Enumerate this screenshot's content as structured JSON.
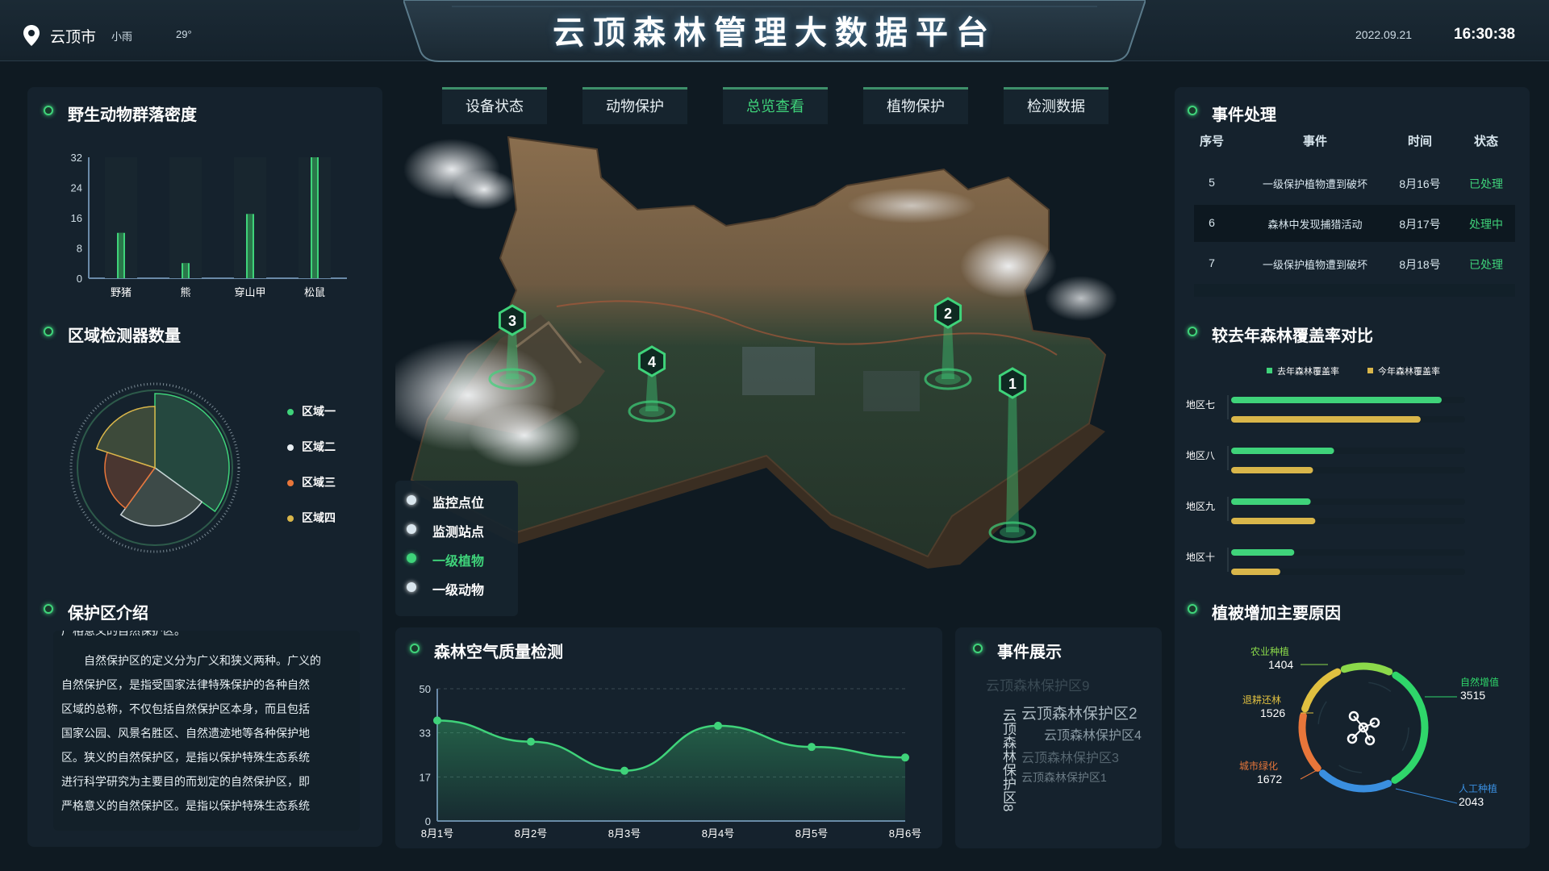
{
  "header": {
    "city": "云顶市",
    "weather": "小雨",
    "temperature": "29°",
    "title": "云顶森林管理大数据平台",
    "date": "2022.09.21",
    "time": "16:30:38"
  },
  "tabs": [
    {
      "label": "设备状态"
    },
    {
      "label": "动物保护"
    },
    {
      "label": "总览查看"
    },
    {
      "label": "植物保护"
    },
    {
      "label": "检测数据"
    }
  ],
  "wildlife": {
    "title": "野生动物群落密度",
    "chart_data": {
      "type": "bar",
      "categories": [
        "野猪",
        "熊",
        "穿山甲",
        "松鼠"
      ],
      "values": [
        12,
        4,
        17,
        32
      ],
      "yticks": [
        "32",
        "24",
        "16",
        "8",
        "0"
      ],
      "ylim": [
        0,
        32
      ],
      "color": "#3fd37a"
    }
  },
  "detectors": {
    "title": "区域检测器数量",
    "chart_data": {
      "type": "pie",
      "categories": [
        "区域一",
        "区域二",
        "区域三",
        "区域四"
      ],
      "values": [
        35,
        25,
        20,
        20
      ],
      "colors": [
        "#3fd37a",
        "#e8eef2",
        "#e8763a",
        "#d9b64a"
      ]
    }
  },
  "intro": {
    "title": "保护区介绍",
    "top_cut": "广格意义的自然保护区。",
    "lines": [
      "自然保护区的定义分为广义和狭义两种。广义的",
      "自然保护区，是指受国家法律特殊保护的各种自然",
      "区域的总称，不仅包括自然保护区本身，而且包括",
      "国家公园、风景名胜区、自然遗迹地等各种保护地",
      "区。狭义的自然保护区，是指以保护特殊生态系统",
      "进行科学研究为主要目的而划定的自然保护区，即",
      "严格意义的自然保护区。是指以保护特殊生态系统"
    ]
  },
  "map": {
    "markers": [
      "1",
      "2",
      "3",
      "4"
    ],
    "legend": [
      {
        "label": "监控点位"
      },
      {
        "label": "监测站点"
      },
      {
        "label": "一级植物"
      },
      {
        "label": "一级动物"
      }
    ]
  },
  "air": {
    "title": "森林空气质量检测",
    "chart_data": {
      "type": "line",
      "categories": [
        "8月1号",
        "8月2号",
        "8月3号",
        "8月4号",
        "8月5号",
        "8月6号"
      ],
      "values": [
        38,
        30,
        19,
        36,
        28,
        24
      ],
      "yticks": [
        "50",
        "33",
        "17",
        "0"
      ],
      "ylim": [
        0,
        50
      ],
      "color": "#3fd37a"
    }
  },
  "showcase": {
    "title": "事件展示",
    "items": [
      "云顶森林保护区9",
      "云顶森林保护区2",
      "云顶森林保护区4",
      "云顶森林保护区3",
      "云顶森林保护区1",
      "云顶森林保护区8"
    ]
  },
  "events": {
    "title": "事件处理",
    "headers": [
      "序号",
      "事件",
      "时间",
      "状态"
    ],
    "rows": [
      {
        "no": "5",
        "event": "一级保护植物遭到破坏",
        "time": "8月16号",
        "status": "已处理"
      },
      {
        "no": "6",
        "event": "森林中发现捕猎活动",
        "time": "8月17号",
        "status": "处理中"
      },
      {
        "no": "7",
        "event": "一级保护植物遭到破坏",
        "time": "8月18号",
        "status": "已处理"
      }
    ]
  },
  "coverage": {
    "title": "较去年森林覆盖率对比",
    "chart_data": {
      "type": "bar",
      "orientation": "horizontal",
      "categories": [
        "地区七",
        "地区八",
        "地区九",
        "地区十"
      ],
      "series": [
        {
          "name": "去年森林覆盖率",
          "values": [
            90,
            44,
            34,
            27
          ],
          "color": "#3fd37a"
        },
        {
          "name": "今年森林覆盖率",
          "values": [
            81,
            35,
            36,
            21
          ],
          "color": "#d9b64a"
        }
      ],
      "xlim": [
        0,
        100
      ]
    }
  },
  "vegetation": {
    "title": "植被增加主要原因",
    "chart_data": {
      "type": "pie",
      "categories": [
        "农业种植",
        "退耕还林",
        "城市绿化",
        "自然增值",
        "人工种植"
      ],
      "values": [
        1404,
        1526,
        1672,
        3515,
        2043
      ],
      "colors": [
        "#8bd94a",
        "#e0c040",
        "#e8763a",
        "#2fd66a",
        "#3a8fe0"
      ]
    }
  }
}
